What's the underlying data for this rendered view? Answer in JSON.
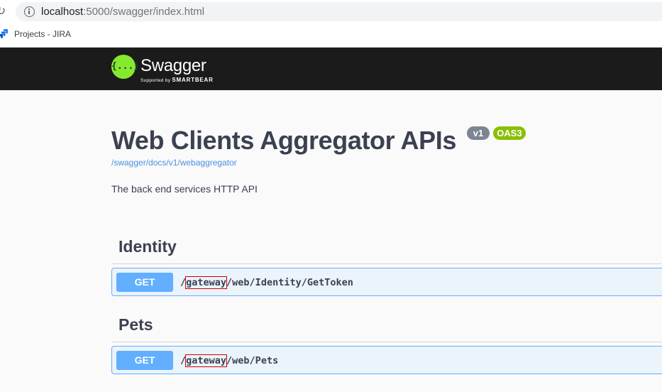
{
  "browser": {
    "url_host": "localhost",
    "url_rest": ":5000/swagger/index.html",
    "bookmark": "Projects - JIRA"
  },
  "topbar": {
    "logo_glyph": "{...}",
    "brand": "Swagger",
    "supported_by": "Supported by",
    "smartbear": "SMARTBEAR"
  },
  "info": {
    "title": "Web Clients Aggregator APIs",
    "version_badge": "v1",
    "oas_badge": "OAS3",
    "spec_url": "/swagger/docs/v1/webaggregator",
    "description": "The back end services HTTP API"
  },
  "tags": [
    {
      "name": "Identity",
      "operations": [
        {
          "method": "GET",
          "path_prefix": "/",
          "path_highlight": "gateway",
          "path_suffix": "/web/Identity/GetToken"
        }
      ]
    },
    {
      "name": "Pets",
      "operations": [
        {
          "method": "GET",
          "path_prefix": "/",
          "path_highlight": "gateway",
          "path_suffix": "/web/Pets"
        }
      ]
    }
  ],
  "colors": {
    "get_accent": "#61affe",
    "swagger_green": "#85ea2d",
    "oas_badge": "#89bf04",
    "version_badge": "#7d8492",
    "highlight_box": "#d00000"
  }
}
